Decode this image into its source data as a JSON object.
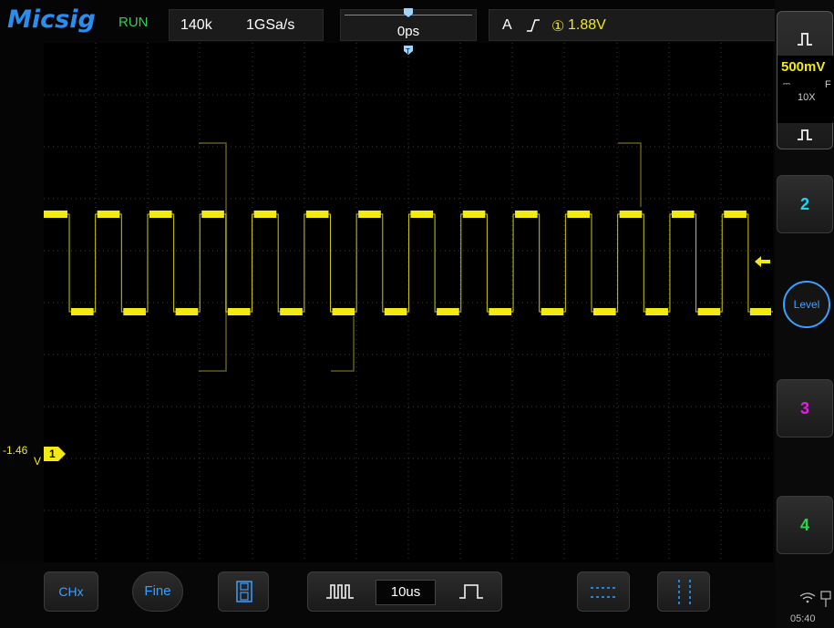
{
  "header": {
    "brand": "Micsig",
    "status": "RUN",
    "memory_depth": "140k",
    "sample_rate": "1GSa/s",
    "time_offset": "0ps",
    "trigger_mode": "A",
    "trigger_channel": "①",
    "trigger_level": "1.88V"
  },
  "channel1": {
    "scale": "500mV",
    "coupling": "F",
    "probe": "10X",
    "marker": "1",
    "offset_value": "-1.46",
    "offset_unit": "V"
  },
  "sidebar": {
    "ch2": "2",
    "ch3": "3",
    "ch4": "4",
    "level_label": "Level"
  },
  "bottom": {
    "chx_label": "CHx",
    "fine_label": "Fine",
    "timebase": "10us"
  },
  "status": {
    "time": "05:40"
  },
  "colors": {
    "ch1": "#f2ea12",
    "ch2": "#22d3ee",
    "ch3": "#e020e0",
    "ch4": "#2ad64a",
    "accent": "#2a8ef0"
  }
}
